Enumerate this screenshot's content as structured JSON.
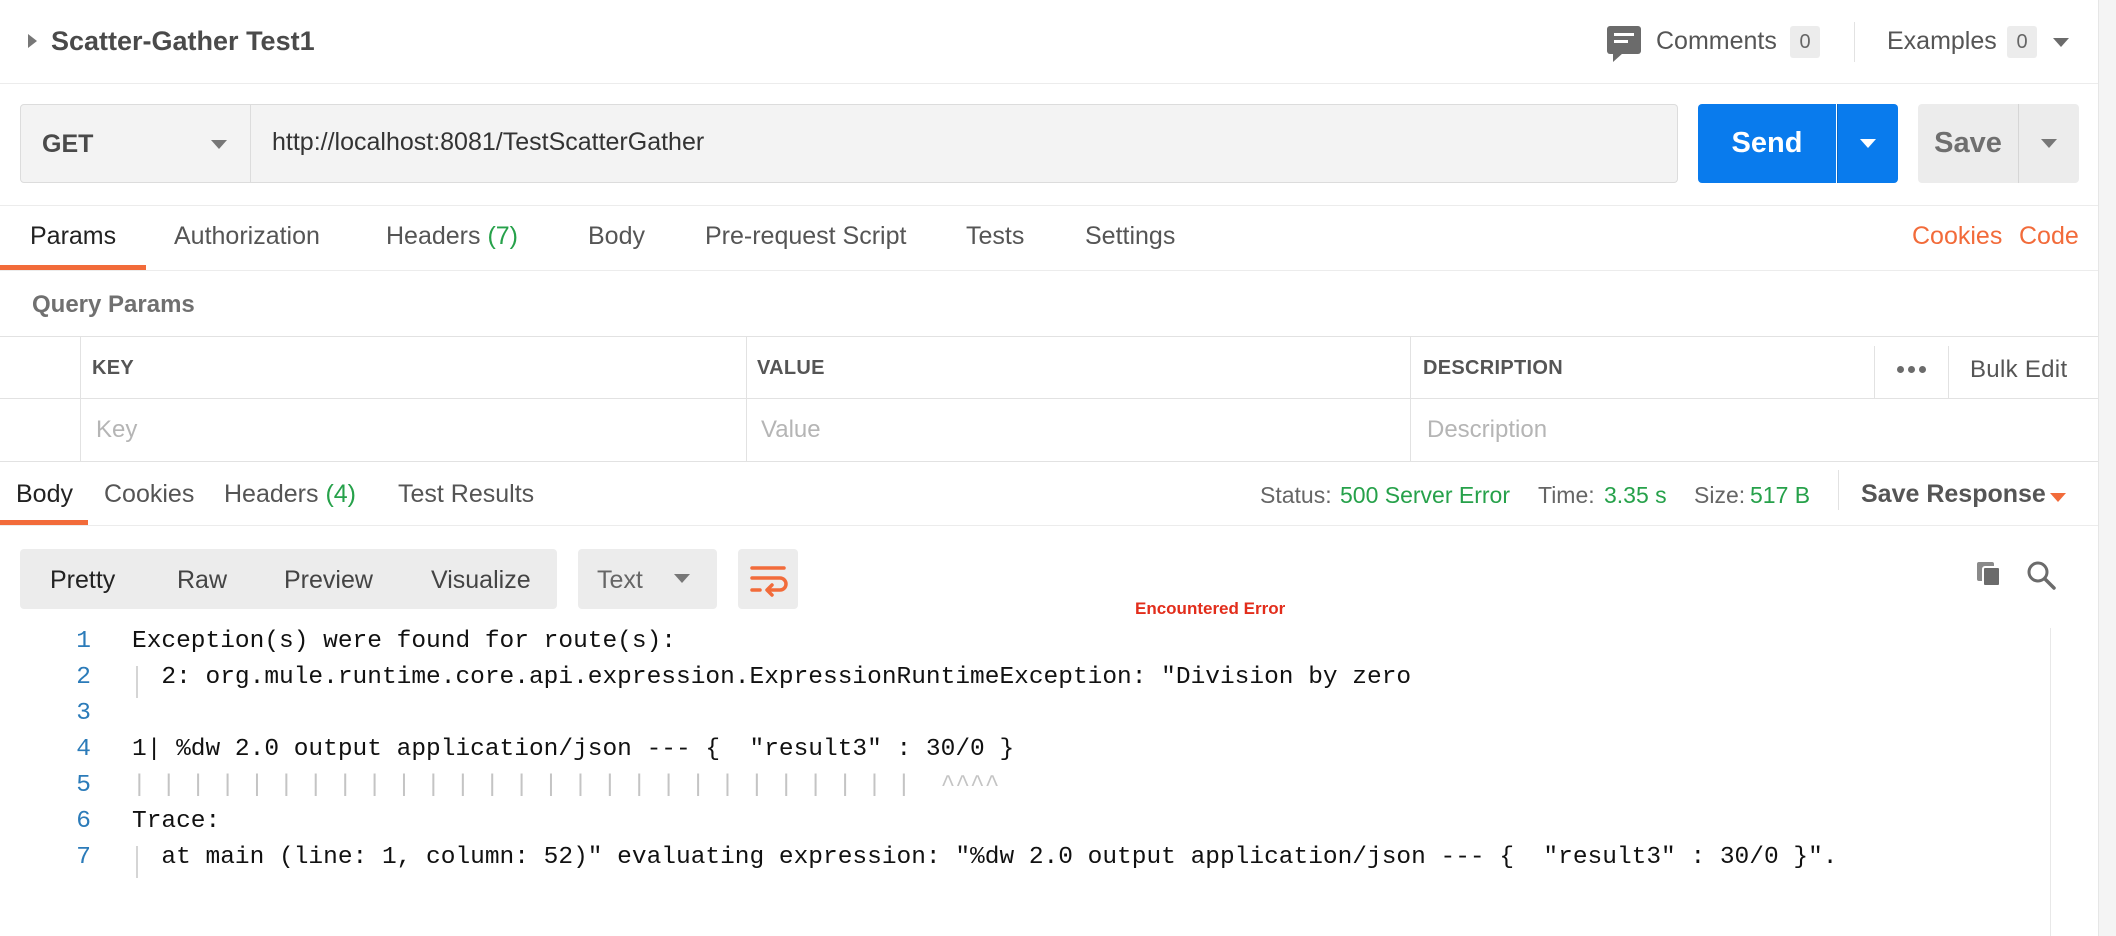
{
  "request": {
    "title": "Scatter-Gather Test1",
    "comments_label": "Comments",
    "comments_count": "0",
    "examples_label": "Examples",
    "examples_count": "0",
    "method": "GET",
    "url": "http://localhost:8081/TestScatterGather",
    "send_label": "Send",
    "save_label": "Save"
  },
  "request_tabs": {
    "params": "Params",
    "authorization": "Authorization",
    "headers": "Headers",
    "headers_count": "(7)",
    "body": "Body",
    "prerequest": "Pre-request Script",
    "tests": "Tests",
    "settings": "Settings",
    "cookies": "Cookies",
    "code": "Code"
  },
  "query_params": {
    "section_label": "Query Params",
    "col_key": "KEY",
    "col_value": "VALUE",
    "col_description": "DESCRIPTION",
    "bulk_edit": "Bulk Edit",
    "key_placeholder": "Key",
    "value_placeholder": "Value",
    "description_placeholder": "Description"
  },
  "response_tabs": {
    "body": "Body",
    "cookies": "Cookies",
    "headers": "Headers",
    "headers_count": "(4)",
    "test_results": "Test Results",
    "status_label": "Status:",
    "status_value": "500 Server Error",
    "time_label": "Time:",
    "time_value": "3.35 s",
    "size_label": "Size:",
    "size_value": "517 B",
    "save_response": "Save Response"
  },
  "body_toolbar": {
    "pretty": "Pretty",
    "raw": "Raw",
    "preview": "Preview",
    "visualize": "Visualize",
    "format": "Text"
  },
  "annotation": "Encountered Error",
  "code_lines": [
    {
      "n": "1",
      "text": "Exception(s) were found for route(s):"
    },
    {
      "n": "2",
      "text": "  2: org.mule.runtime.core.api.expression.ExpressionRuntimeException: \"Division by zero"
    },
    {
      "n": "3",
      "text": ""
    },
    {
      "n": "4",
      "text": "1| %dw 2.0 output application/json --- {  \"result3\" : 30/0 }"
    },
    {
      "n": "5",
      "text": "| | | | | | | | | | | | | | | | | | | | | | | | | | |  ^^^^"
    },
    {
      "n": "6",
      "text": "Trace:"
    },
    {
      "n": "7",
      "text": "  at main (line: 1, column: 52)\" evaluating expression: \"%dw 2.0 output application/json --- {  \"result3\" : 30/0 }\"."
    }
  ],
  "colors": {
    "accent": "#f26b3a",
    "send": "#097bed",
    "success": "#26a14a",
    "error": "#e22d1b",
    "line_number": "#2b7bb9"
  }
}
